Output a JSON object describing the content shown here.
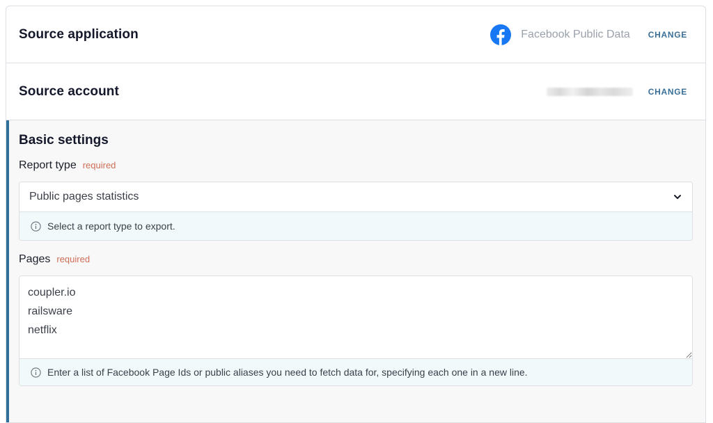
{
  "source_application": {
    "title": "Source application",
    "app_name": "Facebook Public Data",
    "app_icon": "facebook-icon",
    "change_label": "CHANGE",
    "brand_color": "#1877f2"
  },
  "source_account": {
    "title": "Source account",
    "change_label": "CHANGE"
  },
  "basic_settings": {
    "title": "Basic settings",
    "accent_color": "#2f6f9a",
    "report_type": {
      "label": "Report type",
      "required_label": "required",
      "value": "Public pages statistics",
      "hint": "Select a report type to export."
    },
    "pages": {
      "label": "Pages",
      "required_label": "required",
      "value": "coupler.io\nrailsware\nnetflix",
      "hint": "Enter a list of Facebook Page Ids or public aliases you need to fetch data for, specifying each one in a new line."
    }
  }
}
